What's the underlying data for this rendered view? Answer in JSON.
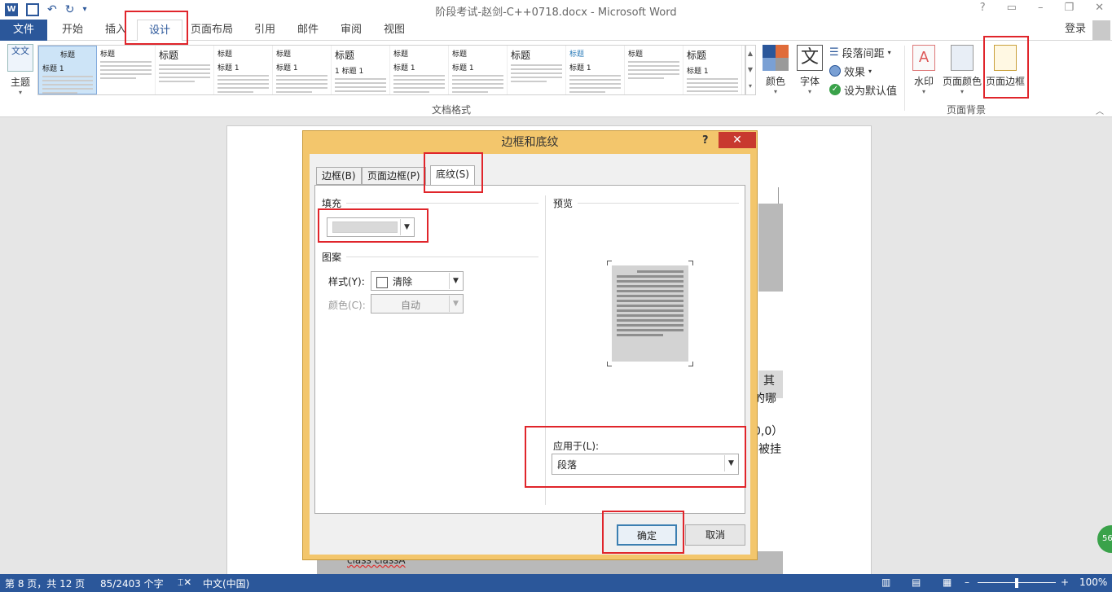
{
  "app": {
    "window_title": "阶段考试-赵剑-C++0718.docx - Microsoft Word",
    "help": "?",
    "login": "登录"
  },
  "tabs": {
    "file": "文件",
    "home": "开始",
    "insert": "插入",
    "design": "设计",
    "layout": "页面布局",
    "references": "引用",
    "mailings": "邮件",
    "review": "审阅",
    "view": "视图"
  },
  "ribbon": {
    "themes": "主题",
    "theme_icon_text": "文文",
    "style_gallery": [
      {
        "title": "标题",
        "sub": "标题 1",
        "selected": true
      },
      {
        "title": "标题",
        "sub": "",
        "selected": false
      },
      {
        "title": "标题",
        "sub": "",
        "selected": false
      },
      {
        "title": "标题",
        "sub": "标题 1",
        "selected": false
      },
      {
        "title": "标题",
        "sub": "标题 1",
        "selected": false
      },
      {
        "title": "标题",
        "sub": "1 标题 1",
        "selected": false
      },
      {
        "title": "标题",
        "sub": "标题 1",
        "selected": false
      },
      {
        "title": "标题",
        "sub": "标题 1",
        "selected": false
      },
      {
        "title": "标题",
        "sub": "",
        "selected": false
      },
      {
        "title": "标题",
        "sub": "标题 1",
        "selected": false
      },
      {
        "title": "标题",
        "sub": "",
        "selected": false
      },
      {
        "title": "标题",
        "sub": "标题 1",
        "selected": false
      }
    ],
    "doc_format_label": "文档格式",
    "colors": "颜色",
    "fonts": "字体",
    "font_icon_text": "文",
    "paragraph_spacing": "段落间距",
    "effects": "效果",
    "set_default": "设为默认值",
    "watermark": "水印",
    "page_color": "页面颜色",
    "page_borders": "页面边框",
    "page_background_label": "页面背景"
  },
  "document": {
    "frag_1": "其",
    "frag_2": "的哪",
    "frag_3": "0,0）",
    "frag_4": "被挂",
    "frag_5": "class classA"
  },
  "dialog": {
    "title": "边框和底纹",
    "help": "?",
    "close": "✕",
    "tabs": [
      "边框(B)",
      "页面边框(P)",
      "底纹(S)"
    ],
    "active_tab": "底纹(S)",
    "fill_label": "填充",
    "fill_color": "#d9d9d9",
    "pattern_label": "图案",
    "style_label": "样式(Y):",
    "style_value": "清除",
    "color_label": "颜色(C):",
    "color_value": "自动",
    "preview_label": "预览",
    "apply_to_label": "应用于(L):",
    "apply_to_value": "段落",
    "ok": "确定",
    "cancel": "取消"
  },
  "status": {
    "page": "第 8 页，共 12 页",
    "words": "85/2403 个字",
    "language": "中文(中国)",
    "zoom": "100%",
    "zoom_level_percent": 100
  },
  "colors": {
    "accent": "#2b579a",
    "dialog_frame": "#f3c66c",
    "close_button": "#c8392f",
    "highlight": "#e0252b"
  }
}
